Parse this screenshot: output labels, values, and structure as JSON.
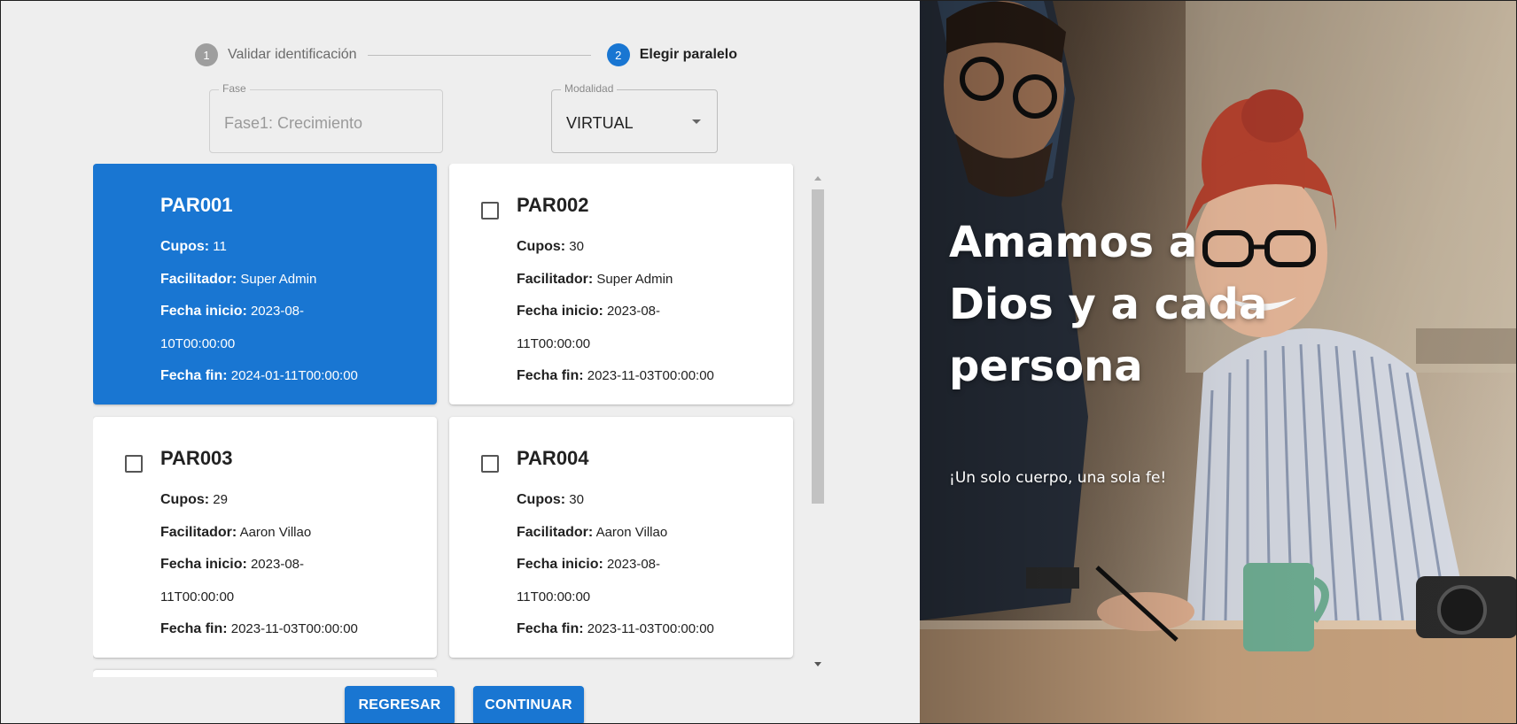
{
  "stepper": {
    "steps": [
      {
        "number": "1",
        "label": "Validar identificación",
        "state": "inactive"
      },
      {
        "number": "2",
        "label": "Elegir paralelo",
        "state": "active"
      }
    ]
  },
  "fase": {
    "legend": "Fase",
    "value": "Fase1: Crecimiento"
  },
  "modalidad": {
    "legend": "Modalidad",
    "value": "VIRTUAL"
  },
  "labels": {
    "cupos": "Cupos:",
    "facilitador": "Facilitador:",
    "fecha_inicio": "Fecha inicio:",
    "fecha_fin": "Fecha fin:"
  },
  "cards": [
    {
      "code": "PAR001",
      "cupos": "11",
      "facilitador": "Super Admin",
      "fecha_inicio_a": "2023-08-",
      "fecha_inicio_b": "10T00:00:00",
      "fecha_fin": "2024-01-11T00:00:00",
      "selected": true
    },
    {
      "code": "PAR002",
      "cupos": "30",
      "facilitador": "Super Admin",
      "fecha_inicio_a": "2023-08-",
      "fecha_inicio_b": "11T00:00:00",
      "fecha_fin": "2023-11-03T00:00:00",
      "selected": false
    },
    {
      "code": "PAR003",
      "cupos": "29",
      "facilitador": "Aaron Villao",
      "fecha_inicio_a": "2023-08-",
      "fecha_inicio_b": "11T00:00:00",
      "fecha_fin": "2023-11-03T00:00:00",
      "selected": false
    },
    {
      "code": "PAR004",
      "cupos": "30",
      "facilitador": "Aaron Villao",
      "fecha_inicio_a": "2023-08-",
      "fecha_inicio_b": "11T00:00:00",
      "fecha_fin": "2023-11-03T00:00:00",
      "selected": false
    }
  ],
  "buttons": {
    "back": "REGRESAR",
    "next": "CONTINUAR"
  },
  "hero": {
    "title": "Amamos a Dios y a cada persona",
    "subtitle": "¡Un solo cuerpo, una sola fe!"
  },
  "colors": {
    "primary": "#1976d2",
    "panel_bg": "#eeeeee",
    "step_inactive": "#9e9e9e"
  }
}
